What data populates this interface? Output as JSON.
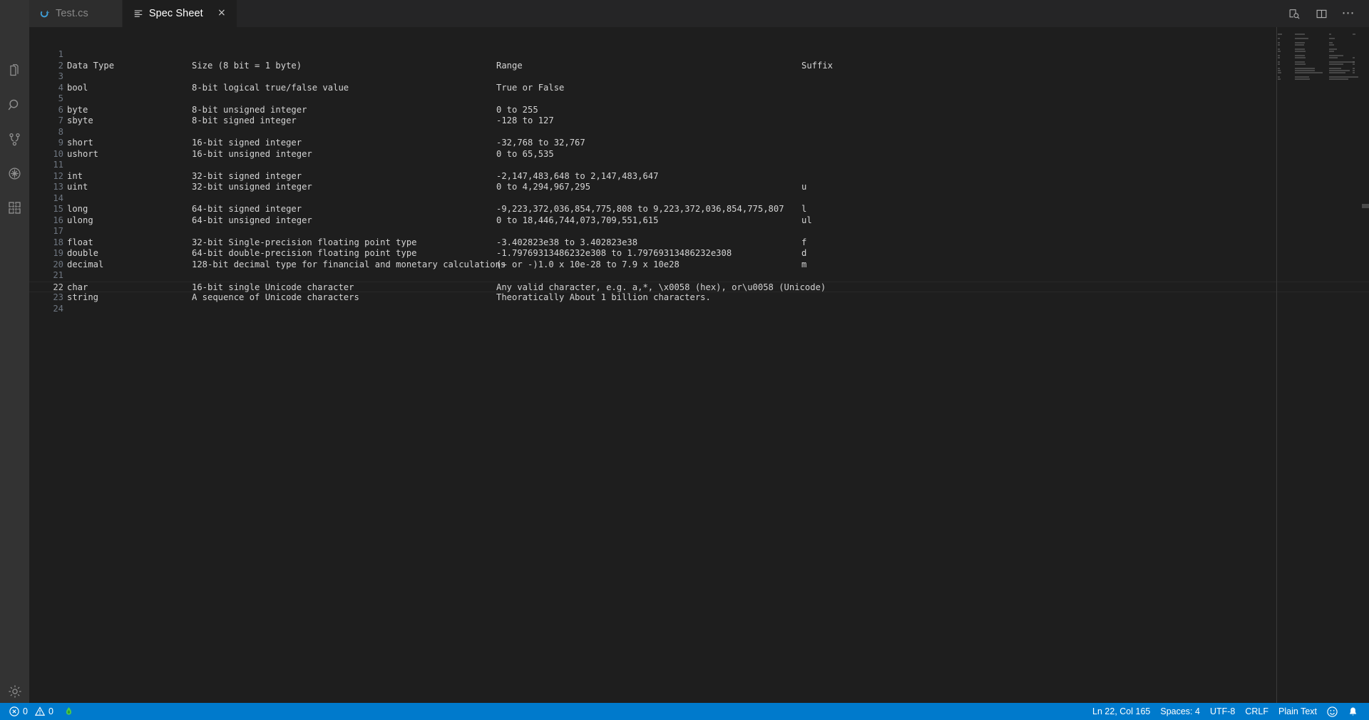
{
  "window": {
    "theme_bg": "#1e1e1e",
    "accent": "#007acc"
  },
  "tabs": [
    {
      "label": "Test.cs",
      "icon": "csharp-file-icon",
      "active": false,
      "close_label": "×"
    },
    {
      "label": "Spec Sheet",
      "icon": "plaintext-file-icon",
      "active": true,
      "close_label": "×"
    }
  ],
  "editor_actions": [
    {
      "name": "open-preview-icon",
      "title": "Open Preview"
    },
    {
      "name": "split-editor-icon",
      "title": "Split Editor"
    },
    {
      "name": "more-actions-icon",
      "title": "More Actions...",
      "glyph": "⋯"
    }
  ],
  "activity_bar": {
    "items": [
      {
        "name": "explorer-icon",
        "label": "Explorer",
        "active": false
      },
      {
        "name": "search-icon",
        "label": "Search",
        "active": false
      },
      {
        "name": "source-control-icon",
        "label": "Source Control",
        "active": false
      },
      {
        "name": "run-and-debug-icon",
        "label": "Run and Debug",
        "active": false
      },
      {
        "name": "extensions-icon",
        "label": "Extensions",
        "active": false
      }
    ],
    "bottom": [
      {
        "name": "settings-gear-icon",
        "label": "Manage"
      }
    ]
  },
  "document": {
    "columns": [
      "Data Type",
      "Size (8 bit = 1 byte)",
      "Range",
      "Suffix"
    ],
    "lines": [
      {
        "n": 1,
        "cols": [
          "",
          "",
          "",
          ""
        ]
      },
      {
        "n": 2,
        "cols": [
          "Data Type",
          "Size (8 bit = 1 byte)",
          "Range",
          "Suffix"
        ]
      },
      {
        "n": 3,
        "cols": [
          "",
          "",
          "",
          ""
        ]
      },
      {
        "n": 4,
        "cols": [
          "bool",
          "8-bit logical true/false value",
          "True or False",
          ""
        ]
      },
      {
        "n": 5,
        "cols": [
          "",
          "",
          "",
          ""
        ]
      },
      {
        "n": 6,
        "cols": [
          "byte",
          "8-bit unsigned integer",
          "0 to 255",
          ""
        ]
      },
      {
        "n": 7,
        "cols": [
          "sbyte",
          "8-bit signed integer",
          "-128 to 127",
          ""
        ]
      },
      {
        "n": 8,
        "cols": [
          "",
          "",
          "",
          ""
        ]
      },
      {
        "n": 9,
        "cols": [
          "short",
          "16-bit signed integer",
          "-32,768 to 32,767",
          ""
        ]
      },
      {
        "n": 10,
        "cols": [
          "ushort",
          "16-bit unsigned integer",
          "0 to 65,535",
          ""
        ]
      },
      {
        "n": 11,
        "cols": [
          "",
          "",
          "",
          ""
        ]
      },
      {
        "n": 12,
        "cols": [
          "int",
          "32-bit signed integer",
          "-2,147,483,648 to 2,147,483,647",
          ""
        ]
      },
      {
        "n": 13,
        "cols": [
          "uint",
          "32-bit unsigned integer",
          "0 to 4,294,967,295",
          "u"
        ]
      },
      {
        "n": 14,
        "cols": [
          "",
          "",
          "",
          ""
        ]
      },
      {
        "n": 15,
        "cols": [
          "long",
          "64-bit signed integer",
          "-9,223,372,036,854,775,808 to 9,223,372,036,854,775,807",
          "l"
        ]
      },
      {
        "n": 16,
        "cols": [
          "ulong",
          "64-bit unsigned integer",
          "0 to 18,446,744,073,709,551,615",
          "ul"
        ]
      },
      {
        "n": 17,
        "cols": [
          "",
          "",
          "",
          ""
        ]
      },
      {
        "n": 18,
        "cols": [
          "float",
          "32-bit Single-precision floating point type",
          "-3.402823e38 to 3.402823e38",
          "f"
        ]
      },
      {
        "n": 19,
        "cols": [
          "double",
          "64-bit double-precision floating point type",
          "-1.79769313486232e308 to 1.79769313486232e308",
          "d"
        ]
      },
      {
        "n": 20,
        "cols": [
          "decimal",
          "128-bit decimal type for financial and monetary calculations",
          "(+ or -)1.0 x 10e-28 to 7.9 x 10e28",
          "m"
        ]
      },
      {
        "n": 21,
        "cols": [
          "",
          "",
          "",
          ""
        ]
      },
      {
        "n": 22,
        "cols": [
          "char",
          "16-bit single Unicode character",
          "Any valid character, e.g. a,*, \\x0058 (hex), or\\u0058 (Unicode)",
          ""
        ],
        "current": true
      },
      {
        "n": 23,
        "cols": [
          "string",
          "A sequence of Unicode characters",
          "Theoratically About 1 billion characters.",
          ""
        ]
      },
      {
        "n": 24,
        "cols": [
          "",
          "",
          "",
          ""
        ]
      }
    ]
  },
  "status_bar": {
    "errors_count": "0",
    "warnings_count": "0",
    "flame_icon": "azure-flame-icon",
    "cursor_position": "Ln 22, Col 165",
    "indentation": "Spaces: 4",
    "encoding": "UTF-8",
    "eol": "CRLF",
    "language_mode": "Plain Text",
    "feedback_icon": "smiley-icon",
    "notifications_icon": "bell-icon"
  }
}
